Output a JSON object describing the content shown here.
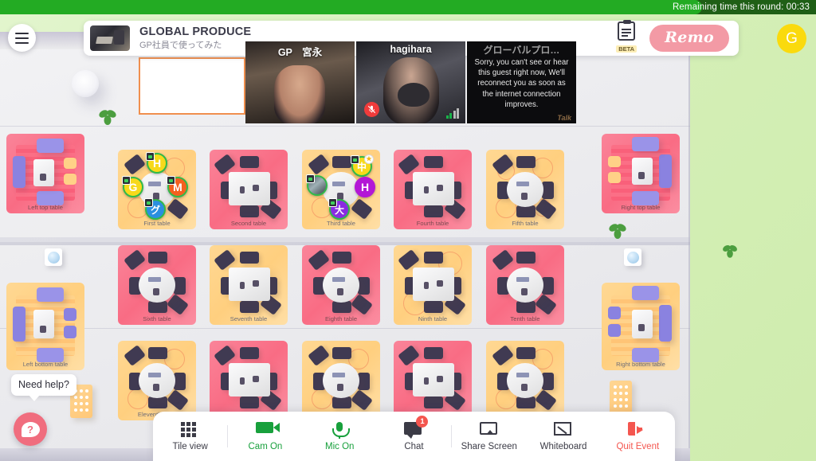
{
  "timer": {
    "label": "Remaining time this round: 00:33",
    "progress_percent": 86,
    "track_color": "#1f5f16",
    "fill_color": "#23ab23"
  },
  "header": {
    "event_title": "GLOBAL PRODUCE",
    "event_subtitle": "GP社員で使ってみた",
    "beta_label": "BETA",
    "brand": "Remo",
    "user_initial": "G",
    "menu_icon": "hamburger-menu-icon"
  },
  "videos": [
    {
      "name": "GP　宮永",
      "muted": false,
      "error": null
    },
    {
      "name": "hagihara",
      "muted": true,
      "error": null
    },
    {
      "name": "グローバルプロ…",
      "muted": false,
      "error": "Sorry, you can't see or hear this guest right now, We'll reconnect you as soon as the internet connection improves.",
      "watermark": "Talk"
    }
  ],
  "tables": [
    {
      "id": "left-top",
      "label": "Left top table",
      "color": "pink",
      "style": "lounge"
    },
    {
      "id": "first",
      "label": "First table",
      "color": "yellow",
      "style": "round",
      "seats": [
        {
          "initial": "H",
          "bg": "#f7d91b",
          "text": "#ffffff",
          "cam": true,
          "host": false
        },
        {
          "initial": "G",
          "bg": "#f7d91b",
          "text": "#ffffff",
          "cam": true,
          "host": false
        },
        {
          "initial": "M",
          "bg": "#f4601f",
          "text": "#ffffff",
          "cam": true,
          "host": false
        },
        {
          "initial": "グ",
          "bg": "#2b8fe0",
          "text": "#ffffff",
          "cam": true,
          "host": false
        }
      ]
    },
    {
      "id": "second",
      "label": "Second table",
      "color": "pink",
      "style": "rect"
    },
    {
      "id": "third",
      "label": "Third table",
      "color": "yellow",
      "style": "round",
      "seats": [
        {
          "initial": "",
          "bg": "photo",
          "text": "#ffffff",
          "cam": true,
          "host": false
        },
        {
          "initial": "中",
          "bg": "#f7d91b",
          "text": "#ffffff",
          "cam": true,
          "host": true
        },
        {
          "initial": "H",
          "bg": "#b317d6",
          "text": "#ffffff",
          "cam": false,
          "host": false
        },
        {
          "initial": "大",
          "bg": "#8a2be2",
          "text": "#ffffff",
          "cam": true,
          "host": false
        }
      ]
    },
    {
      "id": "fourth",
      "label": "Fourth table",
      "color": "pink",
      "style": "rect"
    },
    {
      "id": "fifth",
      "label": "Fifth table",
      "color": "yellow",
      "style": "round"
    },
    {
      "id": "right-top",
      "label": "Right top table",
      "color": "pink",
      "style": "lounge"
    },
    {
      "id": "sixth",
      "label": "Sixth table",
      "color": "pink",
      "style": "round"
    },
    {
      "id": "seventh",
      "label": "Seventh table",
      "color": "yellow",
      "style": "rect"
    },
    {
      "id": "eighth",
      "label": "Eighth table",
      "color": "pink",
      "style": "round"
    },
    {
      "id": "ninth",
      "label": "Ninth table",
      "color": "yellow",
      "style": "rect"
    },
    {
      "id": "tenth",
      "label": "Tenth table",
      "color": "pink",
      "style": "round"
    },
    {
      "id": "left-bottom",
      "label": "Left bottom table",
      "color": "yellow",
      "style": "lounge"
    },
    {
      "id": "right-bottom",
      "label": "Right bottom table",
      "color": "yellow",
      "style": "lounge"
    },
    {
      "id": "eleventh",
      "label": "Eleventh table",
      "color": "yellow",
      "style": "round"
    },
    {
      "id": "twelfth",
      "label": "",
      "color": "pink",
      "style": "rect"
    },
    {
      "id": "thirteenth",
      "label": "",
      "color": "yellow",
      "style": "round"
    },
    {
      "id": "fourteenth",
      "label": "",
      "color": "pink",
      "style": "rect"
    },
    {
      "id": "fifteenth",
      "label": "",
      "color": "yellow",
      "style": "round"
    }
  ],
  "help": {
    "tooltip": "Need help?",
    "icon": "question-mark-chat-icon"
  },
  "toolbar": [
    {
      "id": "tile-view",
      "label": "Tile view",
      "icon": "grid-icon",
      "tone": "dark",
      "badge": null
    },
    {
      "id": "cam",
      "label": "Cam On",
      "icon": "camera-icon",
      "tone": "green",
      "badge": null
    },
    {
      "id": "mic",
      "label": "Mic On",
      "icon": "microphone-icon",
      "tone": "green",
      "badge": null
    },
    {
      "id": "chat",
      "label": "Chat",
      "icon": "chat-bubble-icon",
      "tone": "dark",
      "badge": "1"
    },
    {
      "id": "share-screen",
      "label": "Share Screen",
      "icon": "screen-share-icon",
      "tone": "dark",
      "badge": null
    },
    {
      "id": "whiteboard",
      "label": "Whiteboard",
      "icon": "whiteboard-icon",
      "tone": "dark",
      "badge": null
    },
    {
      "id": "quit-event",
      "label": "Quit Event",
      "icon": "exit-door-icon",
      "tone": "red",
      "badge": null
    }
  ]
}
